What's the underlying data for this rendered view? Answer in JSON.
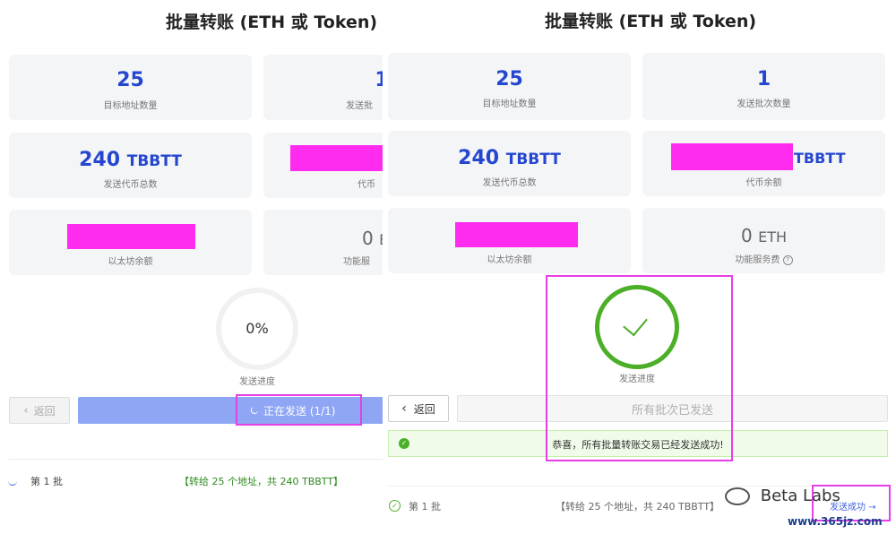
{
  "title": "批量转账 (ETH 或 Token)",
  "stats": {
    "target_count_value": "25",
    "target_count_label": "目标地址数量",
    "batch_count_value": "1",
    "batch_count_label": "发送批次数量",
    "batch_count_label_clipped": "发送批",
    "total_value": "240",
    "total_unit": "TBBTT",
    "total_label": "发送代币总数",
    "token_balance_unit": "TBBTT",
    "token_balance_label": "代币余额",
    "token_balance_label_clipped": "代币",
    "eth_balance_label": "以太坊余额",
    "fee_value": "0",
    "fee_unit": "ETH",
    "fee_unit_clipped": "E",
    "fee_label": "功能服务费",
    "fee_label_clipped": "功能服"
  },
  "left": {
    "progress_percent": "0%",
    "progress_label": "发送进度",
    "back_button": "返回",
    "sending_button": "正在发送 (1/1)",
    "batch_label": "第 1 批",
    "batch_detail": "【转给 25 个地址，共 240 TBBTT】"
  },
  "right": {
    "progress_label": "发送进度",
    "back_button": "返回",
    "all_sent_button": "所有批次已发送",
    "success_message": "恭喜，所有批量转账交易已经发送成功!",
    "batch_label": "第 1 批",
    "batch_detail": "【转给 25 个地址，共 240 TBBTT】",
    "batch_status": "发送成功"
  },
  "watermark": {
    "brand": "Beta Labs",
    "site": "www.365jz.com"
  },
  "colors": {
    "blue_number": "#2547d0",
    "redaction": "#ff2cf0",
    "highlight": "#e63fe6",
    "success_green": "#4caf28",
    "sending_button": "#8fa6f5"
  }
}
